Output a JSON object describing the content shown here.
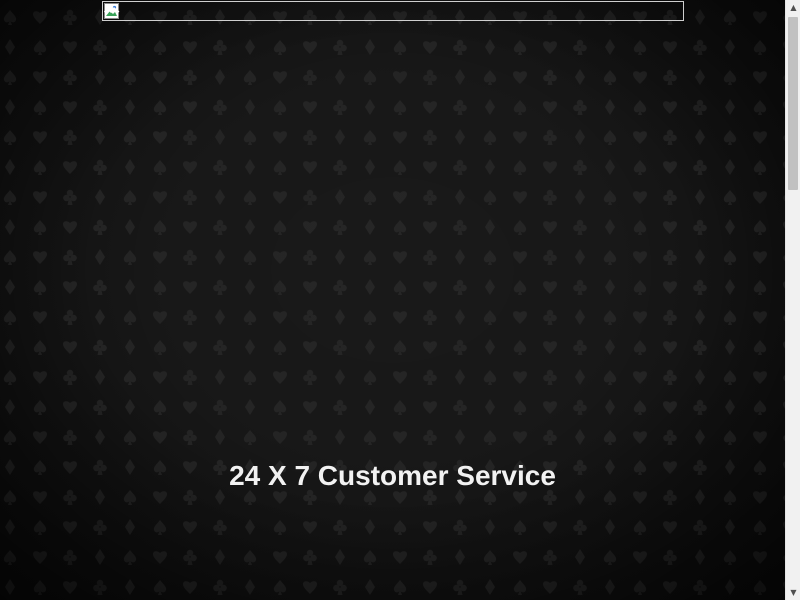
{
  "banner": {
    "image_alt": ""
  },
  "main": {
    "tagline": "24 X 7 Customer Service"
  },
  "background": {
    "pattern_icons": [
      "spade-icon",
      "heart-icon",
      "club-icon",
      "diamond-icon"
    ],
    "base_color": "#191919",
    "pattern_color": "#262626"
  },
  "scrollbar": {
    "up_arrow": "▲",
    "down_arrow": "▼"
  }
}
